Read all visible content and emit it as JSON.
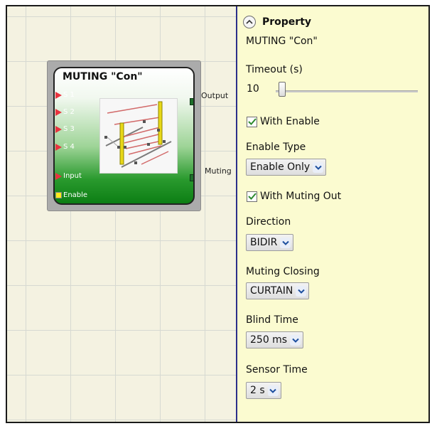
{
  "canvas": {
    "block": {
      "title": "MUTING \"Con\"",
      "inputs": [
        "S 1",
        "S 2",
        "S 3",
        "S 4",
        "Input",
        "Enable"
      ],
      "outputs": [
        "Output",
        "Muting"
      ],
      "image_icon": "muting-light-curtain-icon"
    }
  },
  "property_panel": {
    "header": "Property",
    "collapse_icon": "chevron-up-icon",
    "block_name": "MUTING \"Con\"",
    "timeout": {
      "label": "Timeout (s)",
      "value": "10",
      "slider_fraction": 0.02
    },
    "with_enable": {
      "label": "With Enable",
      "checked": true
    },
    "enable_type": {
      "label": "Enable Type",
      "value": "Enable Only"
    },
    "with_muting_out": {
      "label": "With Muting Out",
      "checked": true
    },
    "direction": {
      "label": "Direction",
      "value": "BIDIR"
    },
    "muting_closing": {
      "label": "Muting Closing",
      "value": "CURTAIN"
    },
    "blind_time": {
      "label": "Blind Time",
      "value": "250 ms"
    },
    "sensor_time": {
      "label": "Sensor Time",
      "value": "2 s"
    }
  },
  "colors": {
    "panel_bg": "#fbfbd0",
    "canvas_bg": "#f4f2e1",
    "block_green": "#2a9a2e",
    "input_pin": "#e8333f",
    "enable_pin": "#ffec1a",
    "checkmark": "#2e8b2e",
    "divider": "#2b2f8a"
  }
}
